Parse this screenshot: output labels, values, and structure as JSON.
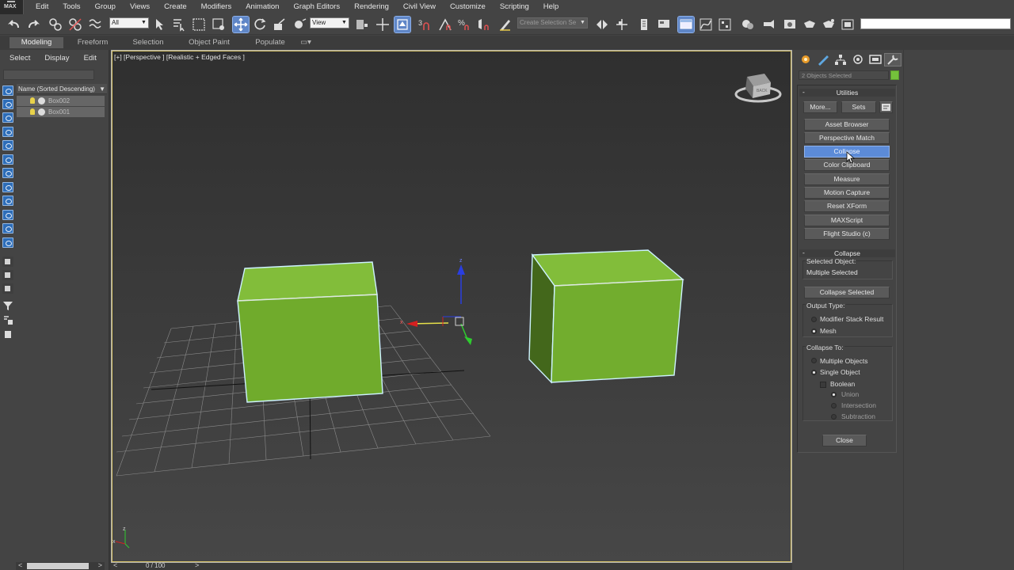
{
  "app": {
    "logo_text": "MAX"
  },
  "menu": [
    "Edit",
    "Tools",
    "Group",
    "Views",
    "Create",
    "Modifiers",
    "Animation",
    "Graph Editors",
    "Rendering",
    "Civil View",
    "Customize",
    "Scripting",
    "Help"
  ],
  "toolbar": {
    "filter_value": "All",
    "ref_coord_value": "View",
    "selection_set_placeholder": "Create Selection Se",
    "snap_label": "3"
  },
  "ribbon": {
    "tabs": [
      "Modeling",
      "Freeform",
      "Selection",
      "Object Paint",
      "Populate"
    ]
  },
  "explorer": {
    "menus": [
      "Select",
      "Display",
      "Edit"
    ],
    "column_header": "Name (Sorted Descending)",
    "sort_arrow": "▼",
    "rows": [
      "Box002",
      "Box001"
    ],
    "scroll_left": "<",
    "scroll_right": ">"
  },
  "viewport": {
    "label": "[+] [Perspective ] [Realistic + Edged Faces ]",
    "viewcube_text": "BACK",
    "gizmo_x_label": "x",
    "gizmo_z_label": "z",
    "axis_x": "x",
    "axis_z": "z",
    "object_color": "#72ad2e",
    "selection_color": "#bfefff"
  },
  "timeline": {
    "frame": "0 / 100",
    "prev": "<",
    "next": ">"
  },
  "command_panel": {
    "selection_info": "2 Objects Selected",
    "object_color": "#74c23b",
    "utilities": {
      "title": "Utilities",
      "collapse_symbol": "-",
      "more_label": "More...",
      "sets_label": "Sets",
      "buttons": [
        "Asset Browser",
        "Perspective Match",
        "Collapse",
        "Color Clipboard",
        "Measure",
        "Motion Capture",
        "Reset XForm",
        "MAXScript",
        "Flight Studio (c)"
      ],
      "selected_index": 2
    },
    "collapse": {
      "title": "Collapse",
      "collapse_symbol": "-",
      "selected_object_label": "Selected Object:",
      "selected_object_value": "Multiple Selected",
      "collapse_selected_label": "Collapse Selected",
      "output_type_label": "Output Type:",
      "output_options": [
        "Modifier Stack Result",
        "Mesh"
      ],
      "output_selected": 1,
      "collapse_to_label": "Collapse To:",
      "collapse_to_options": [
        "Multiple Objects",
        "Single Object"
      ],
      "collapse_to_selected": 1,
      "boolean_label": "Boolean",
      "boolean_options": [
        "Union",
        "Intersection",
        "Subtraction"
      ],
      "boolean_selected": 0,
      "close_label": "Close"
    }
  }
}
